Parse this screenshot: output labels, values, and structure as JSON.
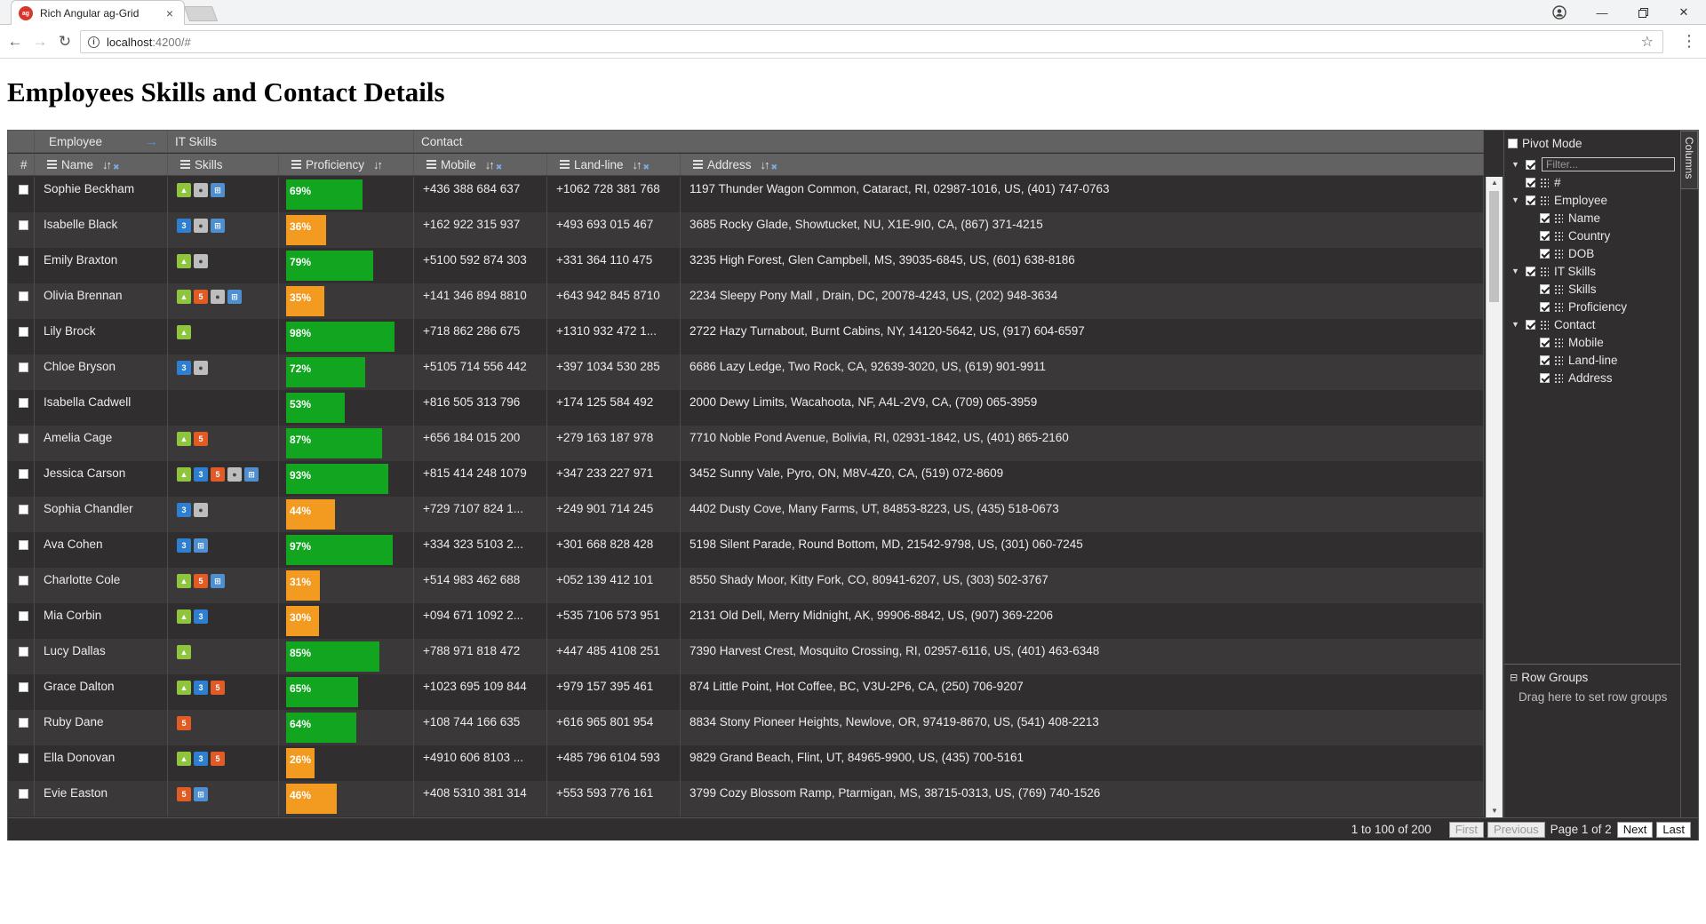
{
  "browser": {
    "tab_title": "Rich Angular ag-Grid",
    "favicon_text": "ag",
    "url_host": "localhost",
    "url_path": ":4200/#"
  },
  "page": {
    "title": "Employees Skills and Contact Details"
  },
  "grid": {
    "group_headers": {
      "employee": "Employee",
      "it_skills": "IT Skills",
      "contact": "Contact"
    },
    "columns": {
      "rownum": "#",
      "name": "Name",
      "skills": "Skills",
      "proficiency": "Proficiency",
      "mobile": "Mobile",
      "landline": "Land-line",
      "address": "Address"
    },
    "rows": [
      {
        "name": "Sophie Beckham",
        "skills": [
          "android",
          "mac",
          "windows"
        ],
        "proficiency": 69,
        "proficiency_label": "69%",
        "mobile": "+436 388 684 637",
        "landline": "+1062 728 381 768",
        "address": "1197 Thunder Wagon Common, Cataract, RI, 02987-1016, US, (401) 747-0763"
      },
      {
        "name": "Isabelle Black",
        "skills": [
          "css",
          "mac",
          "windows"
        ],
        "proficiency": 36,
        "proficiency_label": "36%",
        "mobile": "+162 922 315 937",
        "landline": "+493 693 015 467",
        "address": "3685 Rocky Glade, Showtucket, NU, X1E-9I0, CA, (867) 371-4215"
      },
      {
        "name": "Emily Braxton",
        "skills": [
          "android",
          "mac"
        ],
        "proficiency": 79,
        "proficiency_label": "79%",
        "mobile": "+5100 592 874 303",
        "landline": "+331 364 110 475",
        "address": "3235 High Forest, Glen Campbell, MS, 39035-6845, US, (601) 638-8186"
      },
      {
        "name": "Olivia Brennan",
        "skills": [
          "android",
          "html5",
          "mac",
          "windows"
        ],
        "proficiency": 35,
        "proficiency_label": "35%",
        "mobile": "+141 346 894 8810",
        "landline": "+643 942 845 8710",
        "address": "2234 Sleepy Pony Mall , Drain, DC, 20078-4243, US, (202) 948-3634"
      },
      {
        "name": "Lily Brock",
        "skills": [
          "android"
        ],
        "proficiency": 98,
        "proficiency_label": "98%",
        "mobile": "+718 862 286 675",
        "landline": "+1310 932 472 1...",
        "address": "2722 Hazy Turnabout, Burnt Cabins, NY, 14120-5642, US, (917) 604-6597"
      },
      {
        "name": "Chloe Bryson",
        "skills": [
          "css",
          "mac"
        ],
        "proficiency": 72,
        "proficiency_label": "72%",
        "mobile": "+5105 714 556 442",
        "landline": "+397 1034 530 285",
        "address": "6686 Lazy Ledge, Two Rock, CA, 92639-3020, US, (619) 901-9911"
      },
      {
        "name": "Isabella Cadwell",
        "skills": [],
        "proficiency": 53,
        "proficiency_label": "53%",
        "mobile": "+816 505 313 796",
        "landline": "+174 125 584 492",
        "address": "2000 Dewy Limits, Wacahoota, NF, A4L-2V9, CA, (709) 065-3959"
      },
      {
        "name": "Amelia Cage",
        "skills": [
          "android",
          "html5"
        ],
        "proficiency": 87,
        "proficiency_label": "87%",
        "mobile": "+656 184 015 200",
        "landline": "+279 163 187 978",
        "address": "7710 Noble Pond Avenue, Bolivia, RI, 02931-1842, US, (401) 865-2160"
      },
      {
        "name": "Jessica Carson",
        "skills": [
          "android",
          "css",
          "html5",
          "mac",
          "windows"
        ],
        "proficiency": 93,
        "proficiency_label": "93%",
        "mobile": "+815 414 248 1079",
        "landline": "+347 233 227 971",
        "address": "3452 Sunny Vale, Pyro, ON, M8V-4Z0, CA, (519) 072-8609"
      },
      {
        "name": "Sophia Chandler",
        "skills": [
          "css",
          "mac"
        ],
        "proficiency": 44,
        "proficiency_label": "44%",
        "mobile": "+729 7107 824 1...",
        "landline": "+249 901 714 245",
        "address": "4402 Dusty Cove, Many Farms, UT, 84853-8223, US, (435) 518-0673"
      },
      {
        "name": "Ava Cohen",
        "skills": [
          "css",
          "windows"
        ],
        "proficiency": 97,
        "proficiency_label": "97%",
        "mobile": "+334 323 5103 2...",
        "landline": "+301 668 828 428",
        "address": "5198 Silent Parade, Round Bottom, MD, 21542-9798, US, (301) 060-7245"
      },
      {
        "name": "Charlotte Cole",
        "skills": [
          "android",
          "html5",
          "windows"
        ],
        "proficiency": 31,
        "proficiency_label": "31%",
        "mobile": "+514 983 462 688",
        "landline": "+052 139 412 101",
        "address": "8550 Shady Moor, Kitty Fork, CO, 80941-6207, US, (303) 502-3767"
      },
      {
        "name": "Mia Corbin",
        "skills": [
          "android",
          "css"
        ],
        "proficiency": 30,
        "proficiency_label": "30%",
        "mobile": "+094 671 1092 2...",
        "landline": "+535 7106 573 951",
        "address": "2131 Old Dell, Merry Midnight, AK, 99906-8842, US, (907) 369-2206"
      },
      {
        "name": "Lucy Dallas",
        "skills": [
          "android"
        ],
        "proficiency": 85,
        "proficiency_label": "85%",
        "mobile": "+788 971 818 472",
        "landline": "+447 485 4108 251",
        "address": "7390 Harvest Crest, Mosquito Crossing, RI, 02957-6116, US, (401) 463-6348"
      },
      {
        "name": "Grace Dalton",
        "skills": [
          "android",
          "css",
          "html5"
        ],
        "proficiency": 65,
        "proficiency_label": "65%",
        "mobile": "+1023 695 109 844",
        "landline": "+979 157 395 461",
        "address": "874 Little Point, Hot Coffee, BC, V3U-2P6, CA, (250) 706-9207"
      },
      {
        "name": "Ruby Dane",
        "skills": [
          "html5"
        ],
        "proficiency": 64,
        "proficiency_label": "64%",
        "mobile": "+108 744 166 635",
        "landline": "+616 965 801 954",
        "address": "8834 Stony Pioneer Heights, Newlove, OR, 97419-8670, US, (541) 408-2213"
      },
      {
        "name": "Ella Donovan",
        "skills": [
          "android",
          "css",
          "html5"
        ],
        "proficiency": 26,
        "proficiency_label": "26%",
        "mobile": "+4910 606 8103 ...",
        "landline": "+485 796 6104 593",
        "address": "9829 Grand Beach, Flint, UT, 84965-9900, US, (435) 700-5161"
      },
      {
        "name": "Evie Easton",
        "skills": [
          "html5",
          "windows"
        ],
        "proficiency": 46,
        "proficiency_label": "46%",
        "mobile": "+408 5310 381 314",
        "landline": "+553 593 776 161",
        "address": "3799 Cozy Blossom Ramp, Ptarmigan, MS, 38715-0313, US, (769) 740-1526"
      }
    ],
    "skill_glyphs": {
      "android": "▲",
      "css": "3",
      "html5": "5",
      "mac": "●",
      "windows": "⊞"
    }
  },
  "tool_panel": {
    "side_tab": "Columns",
    "pivot_mode": "Pivot Mode",
    "filter_placeholder": "Filter...",
    "tree": [
      {
        "label": "#",
        "level": 1,
        "group": false
      },
      {
        "label": "Employee",
        "level": 0,
        "group": true
      },
      {
        "label": "Name",
        "level": 2,
        "group": false
      },
      {
        "label": "Country",
        "level": 2,
        "group": false
      },
      {
        "label": "DOB",
        "level": 2,
        "group": false
      },
      {
        "label": "IT Skills",
        "level": 0,
        "group": true
      },
      {
        "label": "Skills",
        "level": 2,
        "group": false
      },
      {
        "label": "Proficiency",
        "level": 2,
        "group": false
      },
      {
        "label": "Contact",
        "level": 0,
        "group": true
      },
      {
        "label": "Mobile",
        "level": 2,
        "group": false
      },
      {
        "label": "Land-line",
        "level": 2,
        "group": false
      },
      {
        "label": "Address",
        "level": 2,
        "group": false
      }
    ],
    "row_groups_title": "Row Groups",
    "row_groups_hint": "Drag here to set row groups"
  },
  "pagination": {
    "summary": "1 to 100 of 200",
    "first": "First",
    "previous": "Previous",
    "page_desc": "Page 1 of 2",
    "next": "Next",
    "last": "Last"
  }
}
